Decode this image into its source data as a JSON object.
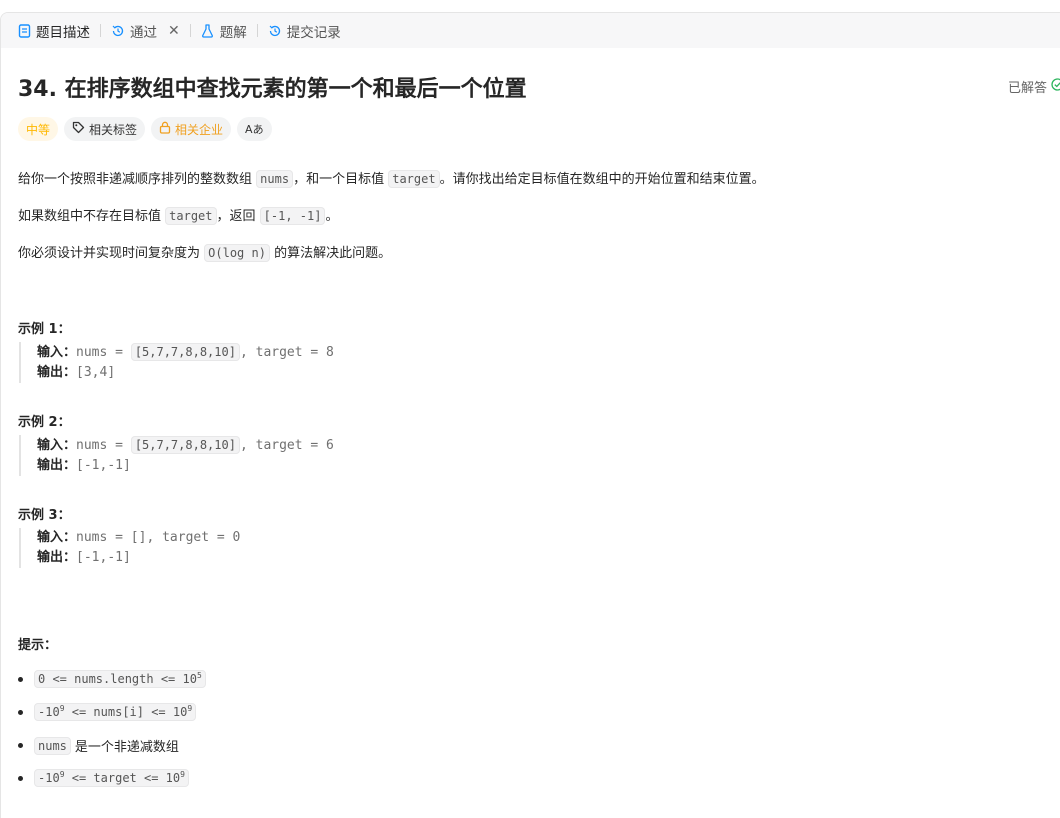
{
  "tabs": [
    {
      "label": "题目描述",
      "icon": "document-icon",
      "active": true
    },
    {
      "label": "通过",
      "icon": "history-icon",
      "closable": true
    },
    {
      "label": "题解",
      "icon": "flask-icon"
    },
    {
      "label": "提交记录",
      "icon": "history-icon"
    }
  ],
  "problem": {
    "title": "34. 在排序数组中查找元素的第一个和最后一个位置",
    "status": "已解答",
    "difficulty": "中等",
    "tags_label": "相关标签",
    "company_label": "相关企业",
    "translate_label": "Aあ"
  },
  "description": {
    "p1_a": "给你一个按照非递减顺序排列的整数数组",
    "p1_code1": "nums",
    "p1_b": "，和一个目标值",
    "p1_code2": "target",
    "p1_c": "。请你找出给定目标值在数组中的开始位置和结束位置。",
    "p2_a": "如果数组中不存在目标值",
    "p2_code1": "target",
    "p2_b": "，返回",
    "p2_code2": "[-1, -1]",
    "p2_c": "。",
    "p3_a": "你必须设计并实现时间复杂度为",
    "p3_code": "O(log n)",
    "p3_b": "的算法解决此问题。"
  },
  "examples": [
    {
      "title": "示例 1：",
      "input_label": "输入：",
      "input_a": "nums = ",
      "input_code": "[5,7,7,8,8,10]",
      "input_b": ", target = 8",
      "output_label": "输出：",
      "output": "[3,4]"
    },
    {
      "title": "示例 2：",
      "input_label": "输入：",
      "input_a": "nums = ",
      "input_code": "[5,7,7,8,8,10]",
      "input_b": ", target = 6",
      "output_label": "输出：",
      "output": "[-1,-1]"
    },
    {
      "title": "示例 3：",
      "input_label": "输入：",
      "input_a": "nums = [], target = 0",
      "output_label": "输出：",
      "output": "[-1,-1]"
    }
  ],
  "tips": {
    "title": "提示：",
    "t1_a": "0 <= nums.length <= 10",
    "t1_sup": "5",
    "t2_a": "-10",
    "t2_sup1": "9",
    "t2_b": " <= nums[i] <= 10",
    "t2_sup2": "9",
    "t3_code": "nums",
    "t3_text": "是一个非递减数组",
    "t4_a": "-10",
    "t4_sup1": "9",
    "t4_b": " <= target <= 10",
    "t4_sup2": "9"
  },
  "colors": {
    "accent": "#1890ff",
    "difficulty": "#ffb800",
    "solved": "#2db55d"
  }
}
